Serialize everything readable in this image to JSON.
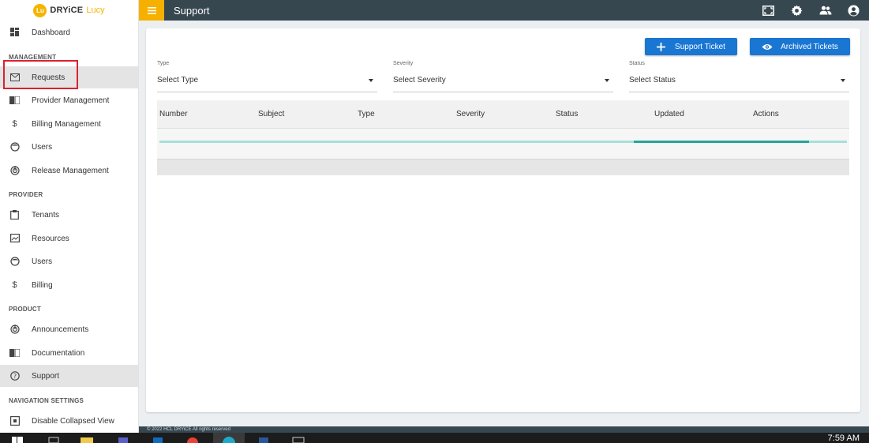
{
  "brand": {
    "badge": "Lu",
    "name": "DRYiCE",
    "product": "Lucy"
  },
  "topbar": {
    "title": "Support"
  },
  "sidebar": {
    "top": [
      {
        "label": "Dashboard",
        "icon": "dashboard-icon"
      }
    ],
    "sections": {
      "management": "MANAGEMENT",
      "provider": "PROVIDER",
      "product": "PRODUCT",
      "nav_settings": "NAVIGATION SETTINGS"
    },
    "management_items": [
      {
        "label": "Requests",
        "icon": "mail-icon"
      },
      {
        "label": "Provider Management",
        "icon": "book-icon"
      },
      {
        "label": "Billing Management",
        "icon": "dollar-icon"
      },
      {
        "label": "Users",
        "icon": "face-icon"
      },
      {
        "label": "Release Management",
        "icon": "radar-icon"
      }
    ],
    "provider_items": [
      {
        "label": "Tenants",
        "icon": "clipboard-icon"
      },
      {
        "label": "Resources",
        "icon": "image-icon"
      },
      {
        "label": "Users",
        "icon": "face-icon"
      },
      {
        "label": "Billing",
        "icon": "dollar-icon"
      }
    ],
    "product_items": [
      {
        "label": "Announcements",
        "icon": "radar-icon"
      },
      {
        "label": "Documentation",
        "icon": "book-icon"
      },
      {
        "label": "Support",
        "icon": "help-icon"
      }
    ],
    "settings_items": [
      {
        "label": "Disable Collapsed View",
        "icon": "collapse-icon"
      }
    ]
  },
  "actions": {
    "support_ticket": "Support Ticket",
    "archived_tickets": "Archived Tickets"
  },
  "filters": {
    "type": {
      "label": "Type",
      "value": "Select Type"
    },
    "severity": {
      "label": "Severity",
      "value": "Select Severity"
    },
    "status": {
      "label": "Status",
      "value": "Select Status"
    }
  },
  "table": {
    "columns": [
      "Number",
      "Subject",
      "Type",
      "Severity",
      "Status",
      "Updated",
      "Actions"
    ],
    "loading_progress": {
      "start": 0.69,
      "end": 0.945
    }
  },
  "footer": {
    "text": "© 2022 HCL DRYiCE All rights reserved"
  },
  "taskbar": {
    "time": "7:59 AM"
  },
  "colors": {
    "topbar": "#37474f",
    "accent": "#f6b000",
    "primary_button": "#1976d2",
    "progress": "#26a69a",
    "highlight": "#d9232e"
  }
}
